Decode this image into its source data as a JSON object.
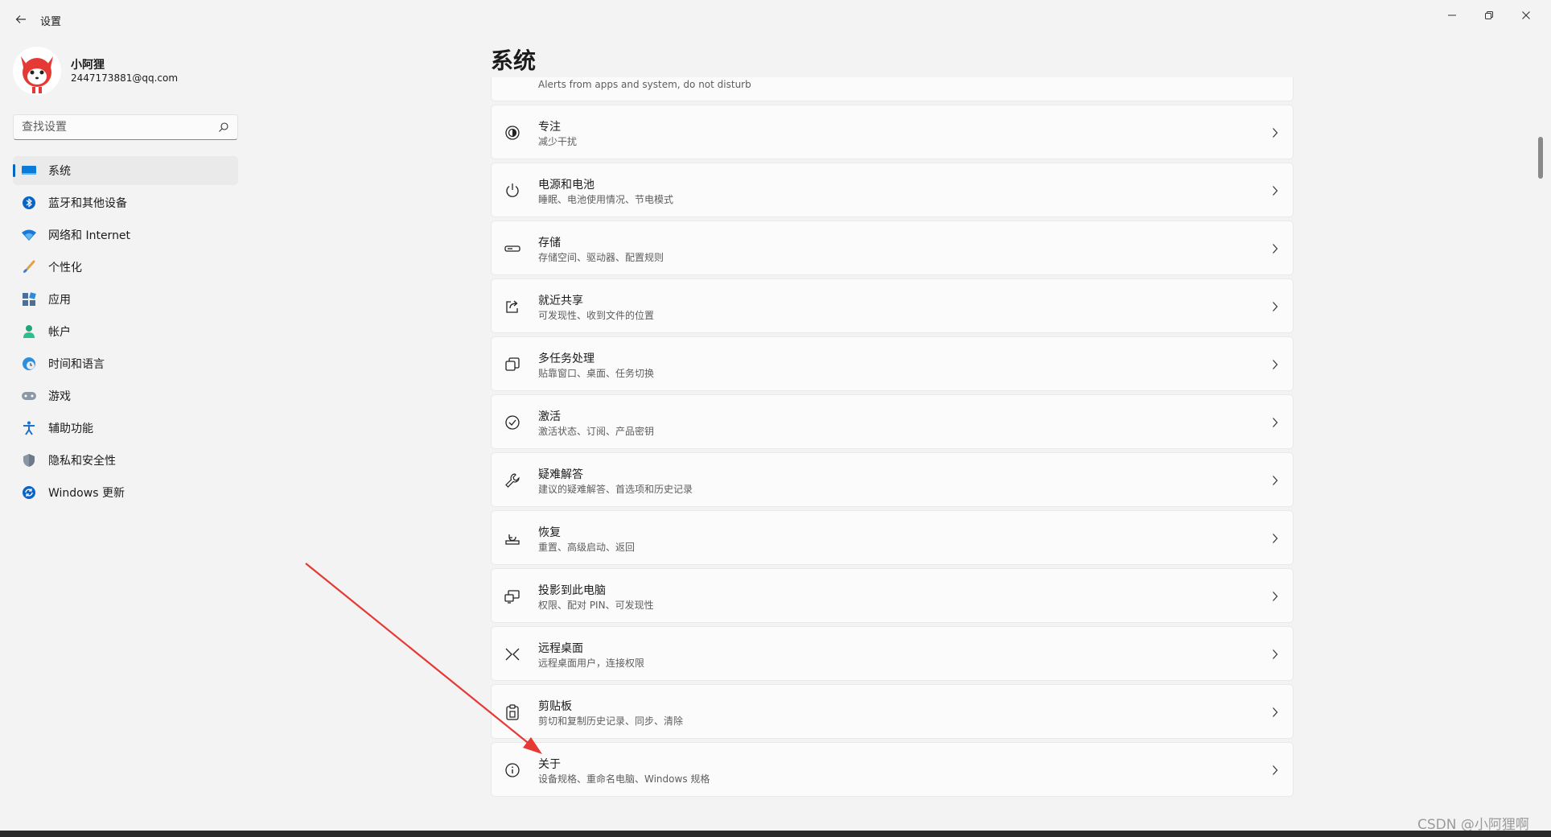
{
  "window": {
    "title": "设置"
  },
  "profile": {
    "name": "小阿狸",
    "email": "2447173881@qq.com"
  },
  "search": {
    "placeholder": "查找设置"
  },
  "nav": [
    {
      "label": "系统",
      "icon": "monitor-icon",
      "active": true
    },
    {
      "label": "蓝牙和其他设备",
      "icon": "bluetooth-icon"
    },
    {
      "label": "网络和 Internet",
      "icon": "wifi-icon"
    },
    {
      "label": "个性化",
      "icon": "brush-icon"
    },
    {
      "label": "应用",
      "icon": "apps-icon"
    },
    {
      "label": "帐户",
      "icon": "person-icon"
    },
    {
      "label": "时间和语言",
      "icon": "globe-clock-icon"
    },
    {
      "label": "游戏",
      "icon": "gamepad-icon"
    },
    {
      "label": "辅助功能",
      "icon": "accessibility-icon"
    },
    {
      "label": "隐私和安全性",
      "icon": "shield-icon"
    },
    {
      "label": "Windows 更新",
      "icon": "update-icon"
    }
  ],
  "main": {
    "title": "系统",
    "partial_item_subtitle": "Alerts from apps and system, do not disturb",
    "items": [
      {
        "title": "专注",
        "subtitle": "减少干扰",
        "icon": "focus-icon"
      },
      {
        "title": "电源和电池",
        "subtitle": "睡眠、电池使用情况、节电模式",
        "icon": "power-icon"
      },
      {
        "title": "存储",
        "subtitle": "存储空间、驱动器、配置规则",
        "icon": "storage-icon"
      },
      {
        "title": "就近共享",
        "subtitle": "可发现性、收到文件的位置",
        "icon": "share-icon"
      },
      {
        "title": "多任务处理",
        "subtitle": "贴靠窗口、桌面、任务切换",
        "icon": "multitask-icon"
      },
      {
        "title": "激活",
        "subtitle": "激活状态、订阅、产品密钥",
        "icon": "check-circle-icon"
      },
      {
        "title": "疑难解答",
        "subtitle": "建议的疑难解答、首选项和历史记录",
        "icon": "wrench-icon"
      },
      {
        "title": "恢复",
        "subtitle": "重置、高级启动、返回",
        "icon": "recovery-icon"
      },
      {
        "title": "投影到此电脑",
        "subtitle": "权限、配对 PIN、可发现性",
        "icon": "projection-icon"
      },
      {
        "title": "远程桌面",
        "subtitle": "远程桌面用户，连接权限",
        "icon": "remote-desktop-icon"
      },
      {
        "title": "剪贴板",
        "subtitle": "剪切和复制历史记录、同步、清除",
        "icon": "clipboard-icon"
      },
      {
        "title": "关于",
        "subtitle": "设备规格、重命名电脑、Windows 规格",
        "icon": "info-icon"
      }
    ]
  },
  "watermark": "CSDN @小阿狸啊",
  "colors": {
    "accent": "#0067c0",
    "annotation_arrow": "#e53935"
  }
}
